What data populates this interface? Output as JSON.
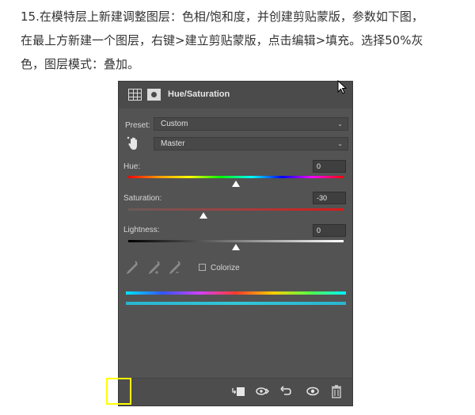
{
  "instruction": {
    "line1": "15.在模特层上新建调整图层：色相/饱和度，并创建剪贴蒙版，参数如下图，",
    "line2": "在最上方新建一个图层，右键>建立剪贴蒙版，点击编辑>填充。选择50%灰",
    "line3": "色，图层模式：叠加。"
  },
  "panel": {
    "title": "Hue/Saturation",
    "preset_label": "Preset:",
    "preset_value": "Custom",
    "channel_value": "Master",
    "hue_label": "Hue:",
    "hue_value": "0",
    "saturation_label": "Saturation:",
    "saturation_value": "-30",
    "lightness_label": "Lightness:",
    "lightness_value": "0",
    "colorize_label": "Colorize",
    "slider_levels": {
      "hue": 0.5,
      "saturation": 0.35,
      "lightness": 0.5
    }
  },
  "icons": {
    "titlebar": [
      "adjustment-grid-icon",
      "layer-mask-icon"
    ],
    "targeted": "hand-adjust-icon",
    "eyedroppers": [
      "eyedropper-icon",
      "eyedropper-plus-icon",
      "eyedropper-minus-icon"
    ],
    "bottom": [
      "clip-to-layer-icon",
      "view-previous-icon",
      "reset-icon",
      "visibility-eye-icon",
      "trash-icon"
    ]
  },
  "highlight_color": "#ffff00"
}
